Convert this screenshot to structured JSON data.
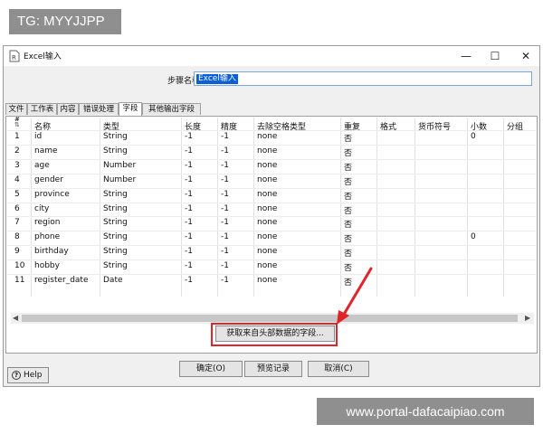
{
  "watermarks": {
    "tg": "TG: MYYJJPP",
    "url": "www.portal-dafacaipiao.com"
  },
  "window": {
    "title": "Excel输入",
    "controls": {
      "minimize": "—",
      "maximize": "☐",
      "close": "✕"
    }
  },
  "step": {
    "label": "步骤名称",
    "value": "Excel输入"
  },
  "tabs": [
    {
      "label": "文件"
    },
    {
      "label": "工作表"
    },
    {
      "label": "内容"
    },
    {
      "label": "错误处理"
    },
    {
      "label": "字段"
    },
    {
      "label": "其他输出字段"
    }
  ],
  "active_tab": "字段",
  "table": {
    "headers": [
      "#",
      "名称",
      "类型",
      "长度",
      "精度",
      "去除空格类型",
      "重复",
      "格式",
      "货币符号",
      "小数",
      "分组"
    ],
    "rows": [
      [
        "1",
        "id",
        "String",
        "-1",
        "-1",
        "none",
        "否",
        "",
        "",
        "0",
        ""
      ],
      [
        "2",
        "name",
        "String",
        "-1",
        "-1",
        "none",
        "否",
        "",
        "",
        "",
        ""
      ],
      [
        "3",
        "age",
        "Number",
        "-1",
        "-1",
        "none",
        "否",
        "",
        "",
        "",
        ""
      ],
      [
        "4",
        "gender",
        "Number",
        "-1",
        "-1",
        "none",
        "否",
        "",
        "",
        "",
        ""
      ],
      [
        "5",
        "province",
        "String",
        "-1",
        "-1",
        "none",
        "否",
        "",
        "",
        "",
        ""
      ],
      [
        "6",
        "city",
        "String",
        "-1",
        "-1",
        "none",
        "否",
        "",
        "",
        "",
        ""
      ],
      [
        "7",
        "region",
        "String",
        "-1",
        "-1",
        "none",
        "否",
        "",
        "",
        "",
        ""
      ],
      [
        "8",
        "phone",
        "String",
        "-1",
        "-1",
        "none",
        "否",
        "",
        "",
        "0",
        ""
      ],
      [
        "9",
        "birthday",
        "String",
        "-1",
        "-1",
        "none",
        "否",
        "",
        "",
        "",
        ""
      ],
      [
        "10",
        "hobby",
        "String",
        "-1",
        "-1",
        "none",
        "否",
        "",
        "",
        "",
        ""
      ],
      [
        "11",
        "register_date",
        "Date",
        "-1",
        "-1",
        "none",
        "否",
        "",
        "",
        "",
        ""
      ]
    ]
  },
  "buttons": {
    "get_fields": "获取来自头部数据的字段...",
    "ok": "确定(O)",
    "preview": "预览记录",
    "cancel": "取消(C)",
    "help": "Help"
  },
  "icons": {
    "help": "?",
    "sort": "⇅",
    "scroll_left": "◀",
    "scroll_right": "▶"
  },
  "colors": {
    "highlight": "#e0242a",
    "selection": "#0a5fd6"
  }
}
